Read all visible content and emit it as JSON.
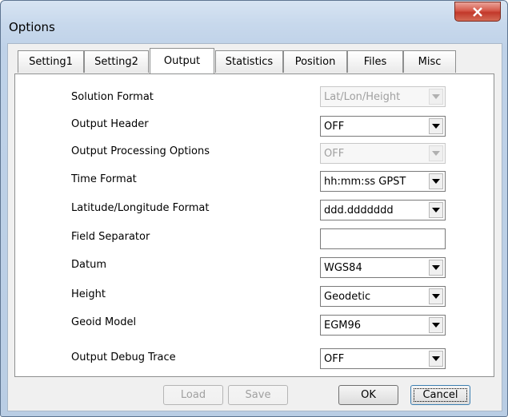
{
  "window": {
    "title": "Options"
  },
  "tabs": [
    {
      "label": "Setting1"
    },
    {
      "label": "Setting2"
    },
    {
      "label": "Output"
    },
    {
      "label": "Statistics"
    },
    {
      "label": "Position"
    },
    {
      "label": "Files"
    },
    {
      "label": "Misc"
    }
  ],
  "form": {
    "solution_format": {
      "label": "Solution Format",
      "value": "Lat/Lon/Height",
      "enabled": false
    },
    "output_header": {
      "label": "Output Header",
      "value": "OFF",
      "enabled": true
    },
    "output_processing_options": {
      "label": "Output Processing Options",
      "value": "OFF",
      "enabled": false
    },
    "time_format": {
      "label": "Time Format",
      "value": "hh:mm:ss GPST",
      "enabled": true
    },
    "latlon_format": {
      "label": "Latitude/Longitude Format",
      "value": "ddd.ddddddd",
      "enabled": true
    },
    "field_separator": {
      "label": "Field Separator",
      "value": ""
    },
    "datum": {
      "label": "Datum",
      "value": "WGS84",
      "enabled": true
    },
    "height": {
      "label": "Height",
      "value": "Geodetic",
      "enabled": true
    },
    "geoid_model": {
      "label": "Geoid Model",
      "value": "EGM96",
      "enabled": true
    },
    "output_debug_trace": {
      "label": "Output Debug Trace",
      "value": "OFF",
      "enabled": true
    }
  },
  "buttons": {
    "load": {
      "label": "Load",
      "enabled": false
    },
    "save": {
      "label": "Save",
      "enabled": false
    },
    "ok": {
      "label": "OK",
      "enabled": true
    },
    "cancel": {
      "label": "Cancel",
      "enabled": true
    }
  },
  "colors": {
    "close_button": "#c2382a",
    "frame": "#bfd2e8"
  }
}
